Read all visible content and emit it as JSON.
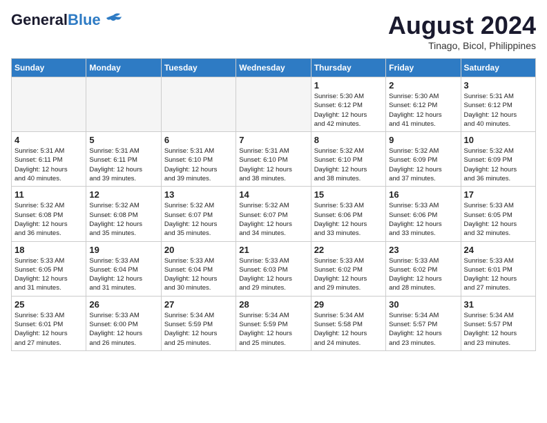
{
  "header": {
    "logo_general": "General",
    "logo_blue": "Blue",
    "month_title": "August 2024",
    "location": "Tinago, Bicol, Philippines"
  },
  "days_of_week": [
    "Sunday",
    "Monday",
    "Tuesday",
    "Wednesday",
    "Thursday",
    "Friday",
    "Saturday"
  ],
  "weeks": [
    [
      {
        "day": "",
        "info": ""
      },
      {
        "day": "",
        "info": ""
      },
      {
        "day": "",
        "info": ""
      },
      {
        "day": "",
        "info": ""
      },
      {
        "day": "1",
        "info": "Sunrise: 5:30 AM\nSunset: 6:12 PM\nDaylight: 12 hours\nand 42 minutes."
      },
      {
        "day": "2",
        "info": "Sunrise: 5:30 AM\nSunset: 6:12 PM\nDaylight: 12 hours\nand 41 minutes."
      },
      {
        "day": "3",
        "info": "Sunrise: 5:31 AM\nSunset: 6:12 PM\nDaylight: 12 hours\nand 40 minutes."
      }
    ],
    [
      {
        "day": "4",
        "info": "Sunrise: 5:31 AM\nSunset: 6:11 PM\nDaylight: 12 hours\nand 40 minutes."
      },
      {
        "day": "5",
        "info": "Sunrise: 5:31 AM\nSunset: 6:11 PM\nDaylight: 12 hours\nand 39 minutes."
      },
      {
        "day": "6",
        "info": "Sunrise: 5:31 AM\nSunset: 6:10 PM\nDaylight: 12 hours\nand 39 minutes."
      },
      {
        "day": "7",
        "info": "Sunrise: 5:31 AM\nSunset: 6:10 PM\nDaylight: 12 hours\nand 38 minutes."
      },
      {
        "day": "8",
        "info": "Sunrise: 5:32 AM\nSunset: 6:10 PM\nDaylight: 12 hours\nand 38 minutes."
      },
      {
        "day": "9",
        "info": "Sunrise: 5:32 AM\nSunset: 6:09 PM\nDaylight: 12 hours\nand 37 minutes."
      },
      {
        "day": "10",
        "info": "Sunrise: 5:32 AM\nSunset: 6:09 PM\nDaylight: 12 hours\nand 36 minutes."
      }
    ],
    [
      {
        "day": "11",
        "info": "Sunrise: 5:32 AM\nSunset: 6:08 PM\nDaylight: 12 hours\nand 36 minutes."
      },
      {
        "day": "12",
        "info": "Sunrise: 5:32 AM\nSunset: 6:08 PM\nDaylight: 12 hours\nand 35 minutes."
      },
      {
        "day": "13",
        "info": "Sunrise: 5:32 AM\nSunset: 6:07 PM\nDaylight: 12 hours\nand 35 minutes."
      },
      {
        "day": "14",
        "info": "Sunrise: 5:32 AM\nSunset: 6:07 PM\nDaylight: 12 hours\nand 34 minutes."
      },
      {
        "day": "15",
        "info": "Sunrise: 5:33 AM\nSunset: 6:06 PM\nDaylight: 12 hours\nand 33 minutes."
      },
      {
        "day": "16",
        "info": "Sunrise: 5:33 AM\nSunset: 6:06 PM\nDaylight: 12 hours\nand 33 minutes."
      },
      {
        "day": "17",
        "info": "Sunrise: 5:33 AM\nSunset: 6:05 PM\nDaylight: 12 hours\nand 32 minutes."
      }
    ],
    [
      {
        "day": "18",
        "info": "Sunrise: 5:33 AM\nSunset: 6:05 PM\nDaylight: 12 hours\nand 31 minutes."
      },
      {
        "day": "19",
        "info": "Sunrise: 5:33 AM\nSunset: 6:04 PM\nDaylight: 12 hours\nand 31 minutes."
      },
      {
        "day": "20",
        "info": "Sunrise: 5:33 AM\nSunset: 6:04 PM\nDaylight: 12 hours\nand 30 minutes."
      },
      {
        "day": "21",
        "info": "Sunrise: 5:33 AM\nSunset: 6:03 PM\nDaylight: 12 hours\nand 29 minutes."
      },
      {
        "day": "22",
        "info": "Sunrise: 5:33 AM\nSunset: 6:02 PM\nDaylight: 12 hours\nand 29 minutes."
      },
      {
        "day": "23",
        "info": "Sunrise: 5:33 AM\nSunset: 6:02 PM\nDaylight: 12 hours\nand 28 minutes."
      },
      {
        "day": "24",
        "info": "Sunrise: 5:33 AM\nSunset: 6:01 PM\nDaylight: 12 hours\nand 27 minutes."
      }
    ],
    [
      {
        "day": "25",
        "info": "Sunrise: 5:33 AM\nSunset: 6:01 PM\nDaylight: 12 hours\nand 27 minutes."
      },
      {
        "day": "26",
        "info": "Sunrise: 5:33 AM\nSunset: 6:00 PM\nDaylight: 12 hours\nand 26 minutes."
      },
      {
        "day": "27",
        "info": "Sunrise: 5:34 AM\nSunset: 5:59 PM\nDaylight: 12 hours\nand 25 minutes."
      },
      {
        "day": "28",
        "info": "Sunrise: 5:34 AM\nSunset: 5:59 PM\nDaylight: 12 hours\nand 25 minutes."
      },
      {
        "day": "29",
        "info": "Sunrise: 5:34 AM\nSunset: 5:58 PM\nDaylight: 12 hours\nand 24 minutes."
      },
      {
        "day": "30",
        "info": "Sunrise: 5:34 AM\nSunset: 5:57 PM\nDaylight: 12 hours\nand 23 minutes."
      },
      {
        "day": "31",
        "info": "Sunrise: 5:34 AM\nSunset: 5:57 PM\nDaylight: 12 hours\nand 23 minutes."
      }
    ]
  ]
}
